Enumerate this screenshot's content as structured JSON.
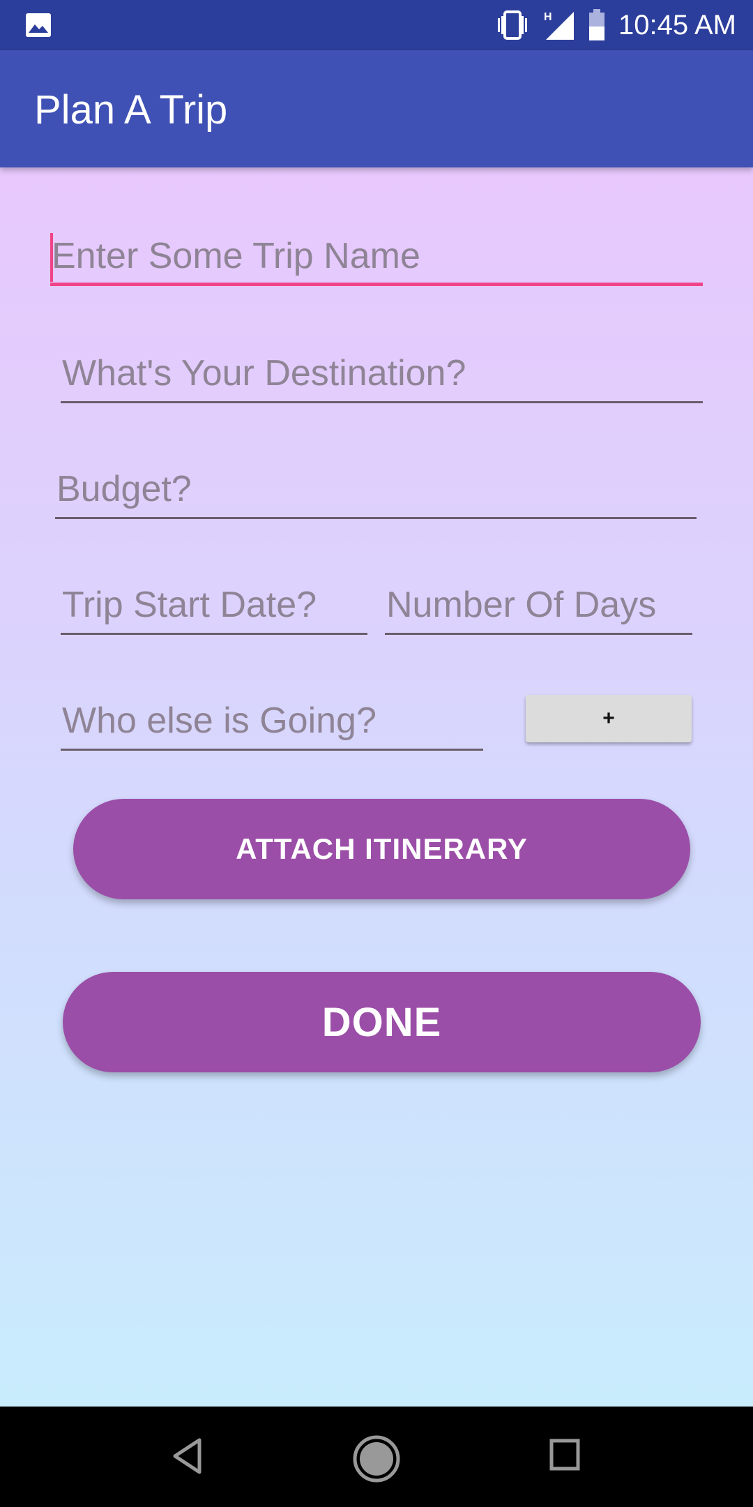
{
  "status_bar": {
    "time": "10:45 AM",
    "network_type": "H",
    "icons": [
      "image-notification-icon",
      "vibrate-icon",
      "signal-icon",
      "battery-icon"
    ]
  },
  "app_bar": {
    "title": "Plan A Trip"
  },
  "form": {
    "trip_name": {
      "placeholder": "Enter Some Trip Name",
      "value": ""
    },
    "destination": {
      "placeholder": "What's Your Destination?",
      "value": ""
    },
    "budget": {
      "placeholder": "Budget?",
      "value": ""
    },
    "start_date": {
      "placeholder": "Trip Start Date?",
      "value": ""
    },
    "num_days": {
      "placeholder": "Number Of Days",
      "value": ""
    },
    "companions": {
      "placeholder": "Who else is Going?",
      "value": ""
    },
    "add_companion_label": "+",
    "attach_label": "ATTACH ITINERARY",
    "done_label": "DONE"
  },
  "colors": {
    "status_bar": "#2c3e9b",
    "app_bar": "#3f51b5",
    "accent": "#f04488",
    "button": "#9b4ea7",
    "gradient_top": "#e8c8fd",
    "gradient_bottom": "#c9ecfd"
  },
  "nav_bar": {
    "icons": [
      "back-icon",
      "home-icon",
      "recents-icon"
    ]
  }
}
